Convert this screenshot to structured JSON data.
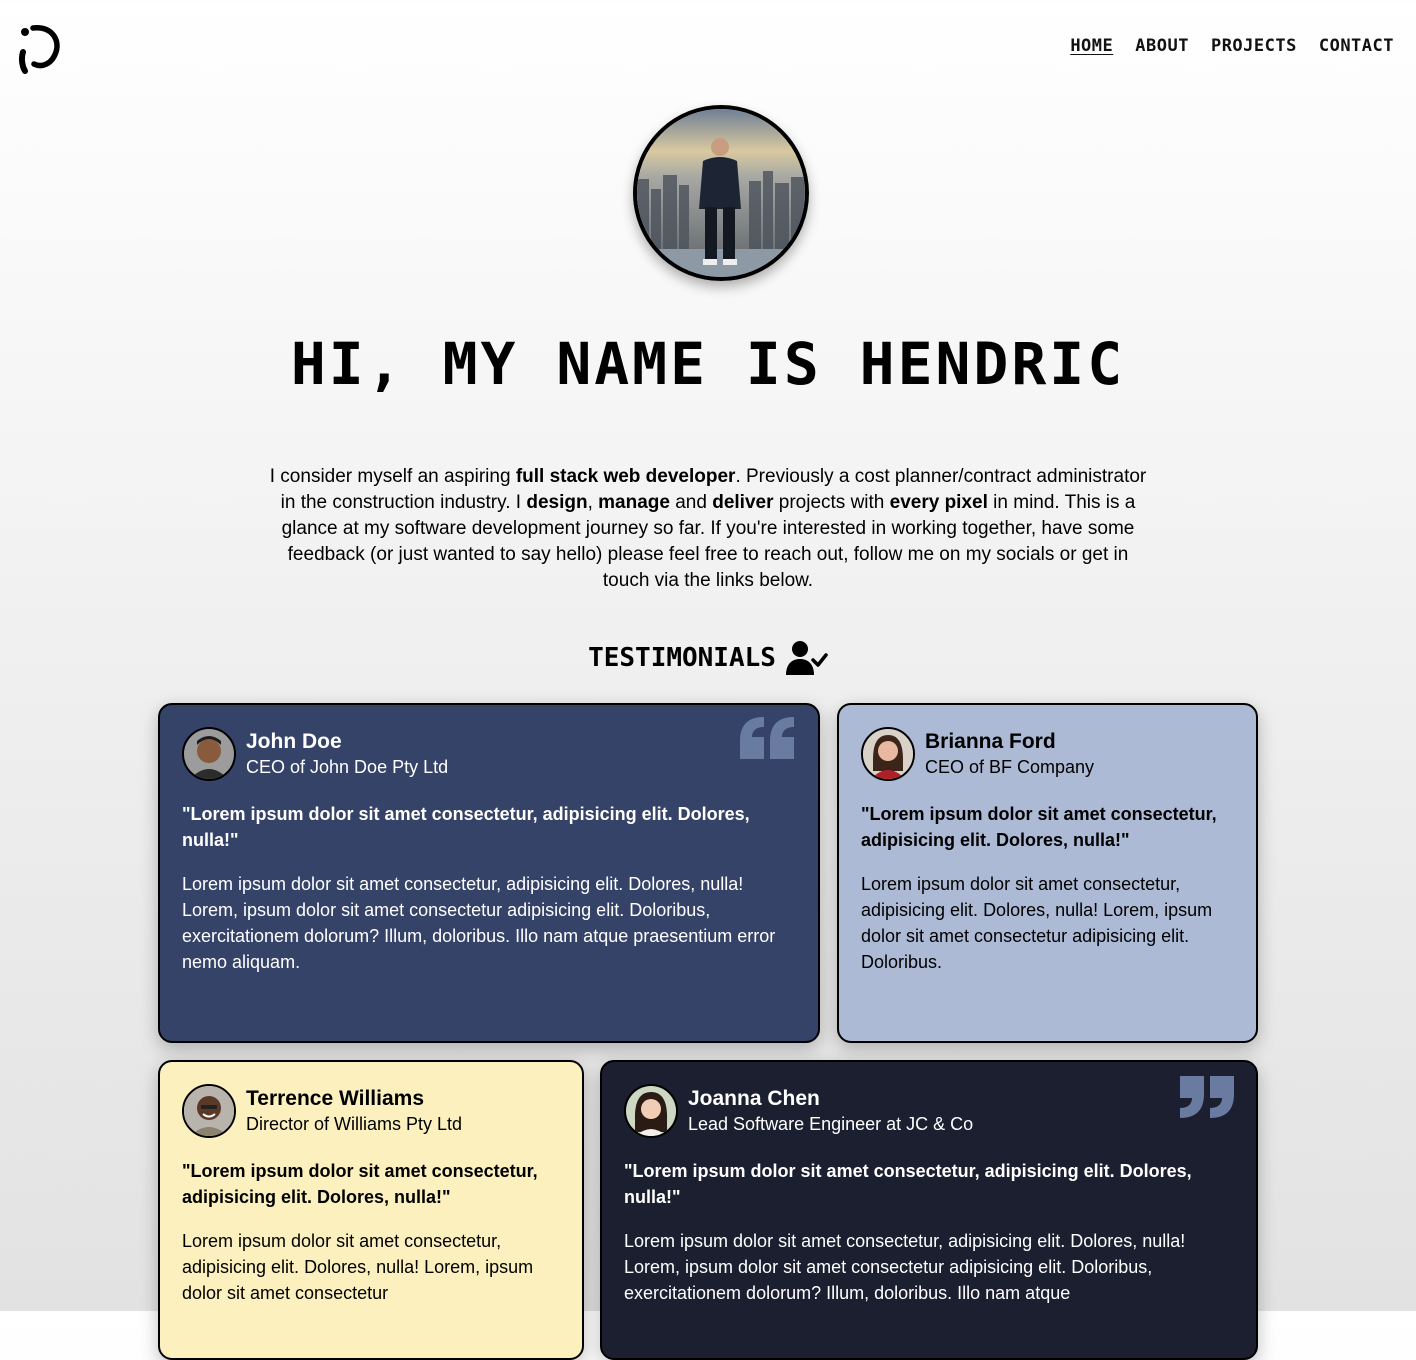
{
  "nav": {
    "home": "HOME",
    "about": "ABOUT",
    "projects": "PROJECTS",
    "contact": "CONTACT"
  },
  "hero": {
    "title": "HI, MY NAME IS HENDRIC",
    "intro": {
      "p1": "I consider myself an aspiring ",
      "b1": "full stack web developer",
      "p2": ". Previously a cost planner/contract administrator in the construction industry. I ",
      "b2": "design",
      "p3": ", ",
      "b3": "manage",
      "p4": " and ",
      "b4": "deliver",
      "p5": " projects with ",
      "b5": "every pixel",
      "p6": " in mind. This is a glance at my software development journey so far. If you're interested in working together, have some feedback (or just wanted to say hello) please feel free to reach out, follow me on my socials or get in touch via the links below."
    }
  },
  "testimonials": {
    "heading": "TESTIMONIALS",
    "icon": "user-check-icon",
    "cards": [
      {
        "name": "John Doe",
        "role": "CEO of John Doe Pty Ltd",
        "quote": "\"Lorem ipsum dolor sit amet consectetur, adipisicing elit. Dolores, nulla!\"",
        "body": "Lorem ipsum dolor sit amet consectetur, adipisicing elit. Dolores, nulla! Lorem, ipsum dolor sit amet consectetur adipisicing elit. Doloribus, exercitationem dolorum? Illum, doloribus. Illo nam atque praesentium error nemo aliquam.",
        "color": "#364369"
      },
      {
        "name": "Brianna Ford",
        "role": "CEO of BF Company",
        "quote": "\"Lorem ipsum dolor sit amet consectetur, adipisicing elit. Dolores, nulla!\"",
        "body": "Lorem ipsum dolor sit amet consectetur, adipisicing elit. Dolores, nulla! Lorem, ipsum dolor sit amet consectetur adipisicing elit. Doloribus.",
        "color": "#adbad5"
      },
      {
        "name": "Terrence Williams",
        "role": "Director of Williams Pty Ltd",
        "quote": "\"Lorem ipsum dolor sit amet consectetur, adipisicing elit. Dolores, nulla!\"",
        "body": "Lorem ipsum dolor sit amet consectetur, adipisicing elit. Dolores, nulla! Lorem, ipsum dolor sit amet consectetur",
        "color": "#fbf0be"
      },
      {
        "name": "Joanna Chen",
        "role": "Lead Software Engineer at JC & Co",
        "quote": "\"Lorem ipsum dolor sit amet consectetur, adipisicing elit. Dolores, nulla!\"",
        "body": "Lorem ipsum dolor sit amet consectetur, adipisicing elit. Dolores, nulla! Lorem, ipsum dolor sit amet consectetur adipisicing elit. Doloribus, exercitationem dolorum? Illum, doloribus. Illo nam atque",
        "color": "#1b1f30"
      }
    ]
  }
}
